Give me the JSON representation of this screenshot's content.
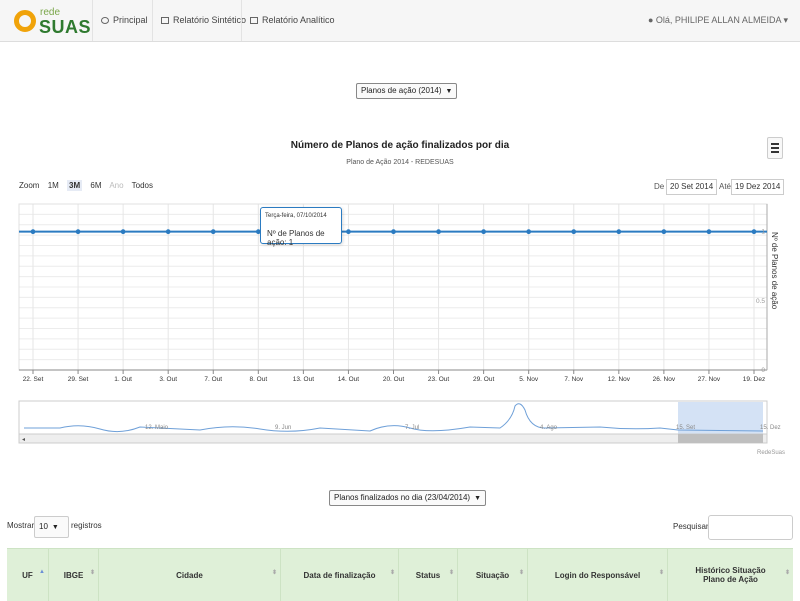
{
  "nav": {
    "logo_small": "rede",
    "logo_big": "SUAS",
    "items": [
      {
        "label": "Principal"
      },
      {
        "label": "Relatório Sintético"
      },
      {
        "label": "Relatório Analítico"
      }
    ],
    "user": "Olá, PHILIPE ALLAN ALMEIDA"
  },
  "report_select": "Planos de ação (2014)",
  "chart": {
    "title": "Número de Planos de ação finalizados por dia",
    "subtitle": "Plano de Ação 2014 - REDESUAS",
    "zoom_label": "Zoom",
    "zoom_options": [
      {
        "label": "1M"
      },
      {
        "label": "3M",
        "selected": true
      },
      {
        "label": "6M"
      },
      {
        "label": "Ano",
        "disabled": true
      },
      {
        "label": "Todos"
      }
    ],
    "from_label": "De",
    "from_value": "20 Set 2014",
    "to_label": "Até",
    "to_value": "19 Dez 2014",
    "tooltip_date": "Terça-feira, 07/10/2014",
    "tooltip_value": "Nº de Planos de ação: 1",
    "credits": "RedeSuas",
    "line_color": "#2b7bc1"
  },
  "chart_data": {
    "type": "line",
    "series": [
      {
        "name": "Nº de Planos de ação",
        "x": [
          "22. Set",
          "29. Set",
          "1. Out",
          "3. Out",
          "7. Out",
          "8. Out",
          "13. Out",
          "14. Out",
          "20. Out",
          "23. Out",
          "29. Out",
          "5. Nov",
          "7. Nov",
          "12. Nov",
          "26. Nov",
          "27. Nov",
          "19. Dez"
        ],
        "values": [
          1,
          1,
          1,
          1,
          1,
          1,
          1,
          1,
          1,
          1,
          1,
          1,
          1,
          1,
          1,
          1,
          1
        ]
      }
    ],
    "x_tick_labels": [
      "22. Set",
      "29. Set",
      "1. Out",
      "3. Out",
      "7. Out",
      "8. Out",
      "13. Out",
      "14. Out",
      "20. Out",
      "23. Out",
      "29. Out",
      "5. Nov",
      "7. Nov",
      "12. Nov",
      "26. Nov",
      "27. Nov",
      "19. Dez"
    ],
    "ylabel": "Nº de Planos de ação",
    "y_tick_labels": [
      "1",
      "0.5",
      "0"
    ],
    "ylim": [
      0,
      1.2
    ],
    "navigator_labels": [
      "12. Maio",
      "9. Jun",
      "7. Jul",
      "4. Ago",
      "15. Set",
      "15. Dez"
    ],
    "grid": true
  },
  "day_select": "Planos finalizados no dia (23/04/2014)",
  "table": {
    "show_label": "Mostrar",
    "show_value": "10",
    "records_label": "registros",
    "search_label": "Pesquisar",
    "columns": [
      "UF",
      "IBGE",
      "Cidade",
      "Data de finalização",
      "Status",
      "Situação",
      "Login do Responsável",
      "Histórico Situação Plano de Ação"
    ]
  }
}
